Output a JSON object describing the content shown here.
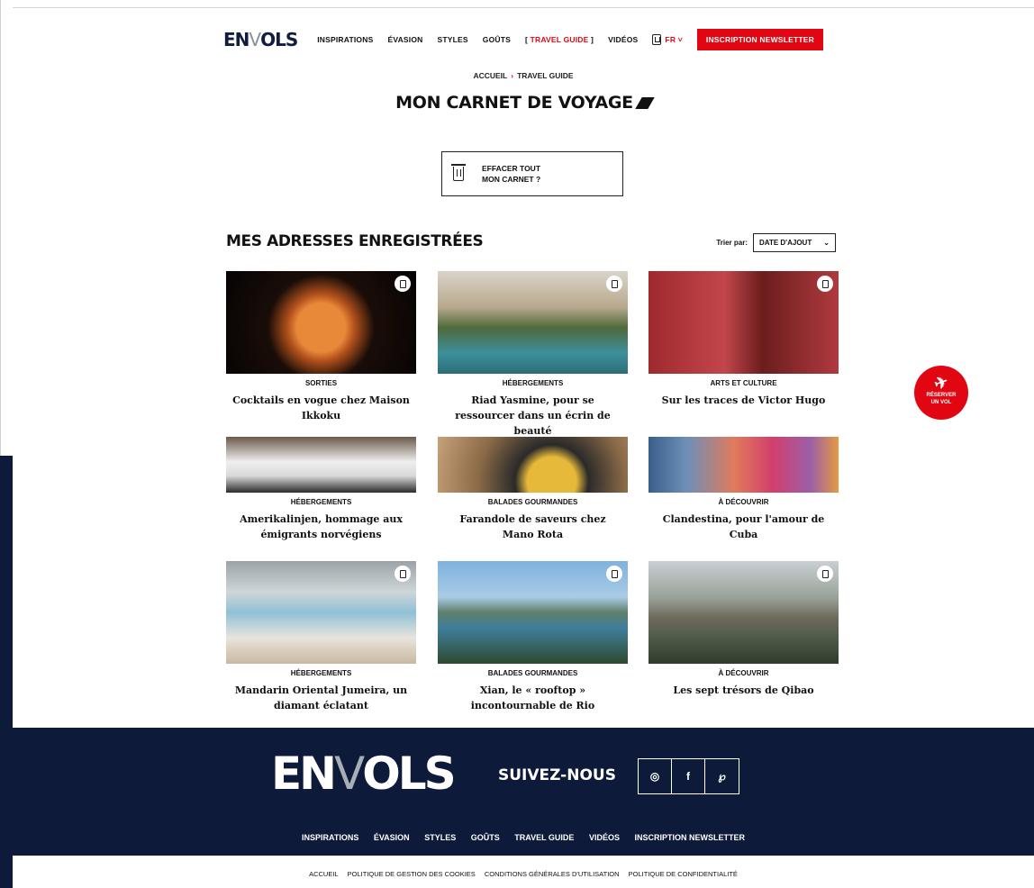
{
  "header": {
    "logo_main": "EN",
    "logo_accent": "V",
    "logo_tail": "OLS",
    "nav": [
      "INSPIRATIONS",
      "ÉVASION",
      "STYLES",
      "GOÛTS"
    ],
    "travel_guide": "TRAVEL GUIDE",
    "videos": "VIDÉOS",
    "lang": "FR ˅",
    "newsletter": "INSCRIPTION NEWSLETTER"
  },
  "breadcrumb": {
    "home": "ACCUEIL",
    "sep": "›",
    "current": "TRAVEL GUIDE"
  },
  "page_title": "MON CARNET DE VOYAGE",
  "clear": {
    "line1": "EFFACER TOUT",
    "line2": "MON CARNET ?"
  },
  "section_title": "MES ADRESSES ENREGISTRÉES",
  "sort": {
    "label": "Trier par:",
    "value": "DATE D'AJOUT"
  },
  "cards": [
    {
      "cat": "SORTIES",
      "title": "Cocktails en vogue chez Maison Ikkoku"
    },
    {
      "cat": "HÉBERGEMENTS",
      "title": "Riad Yasmine, pour se ressourcer dans un écrin de beauté"
    },
    {
      "cat": "ARTS ET CULTURE",
      "title": "Sur les traces de Victor Hugo"
    },
    {
      "cat": "HÉBERGEMENTS",
      "title": "Amerikalinjen, hommage aux émigrants norvégiens"
    },
    {
      "cat": "BALADES GOURMANDES",
      "title": "Farandole de saveurs chez Mano Rota"
    },
    {
      "cat": "À DÉCOUVRIR",
      "title": "Clandestina, pour l'amour de Cuba"
    },
    {
      "cat": "HÉBERGEMENTS",
      "title": "Mandarin Oriental Jumeira, un diamant éclatant"
    },
    {
      "cat": "BALADES GOURMANDES",
      "title": "Xian, le « rooftop » incontournable de Rio"
    },
    {
      "cat": "À DÉCOUVRIR",
      "title": "Les sept trésors de Qibao"
    }
  ],
  "cta": {
    "line1": "RÉSERVER",
    "line2": "UN VOL"
  },
  "footer": {
    "logo_main": "EN",
    "logo_accent": "V",
    "logo_tail": "OLS",
    "follow": "SUIVEZ-NOUS",
    "socials": [
      "◎",
      "f",
      "℘"
    ],
    "nav": [
      "INSPIRATIONS",
      "ÉVASION",
      "STYLES",
      "GOÛTS",
      "TRAVEL GUIDE",
      "VIDÉOS",
      "INSCRIPTION NEWSLETTER"
    ],
    "legal": [
      "ACCUEIL",
      "POLITIQUE DE GESTION DES COOKIES",
      "CONDITIONS GÉNÉRALES D'UTILISATION",
      "POLITIQUE DE CONFIDENTIALITÉ"
    ]
  },
  "colors": {
    "accent": "#e20613",
    "navy": "#0e1a3a"
  }
}
